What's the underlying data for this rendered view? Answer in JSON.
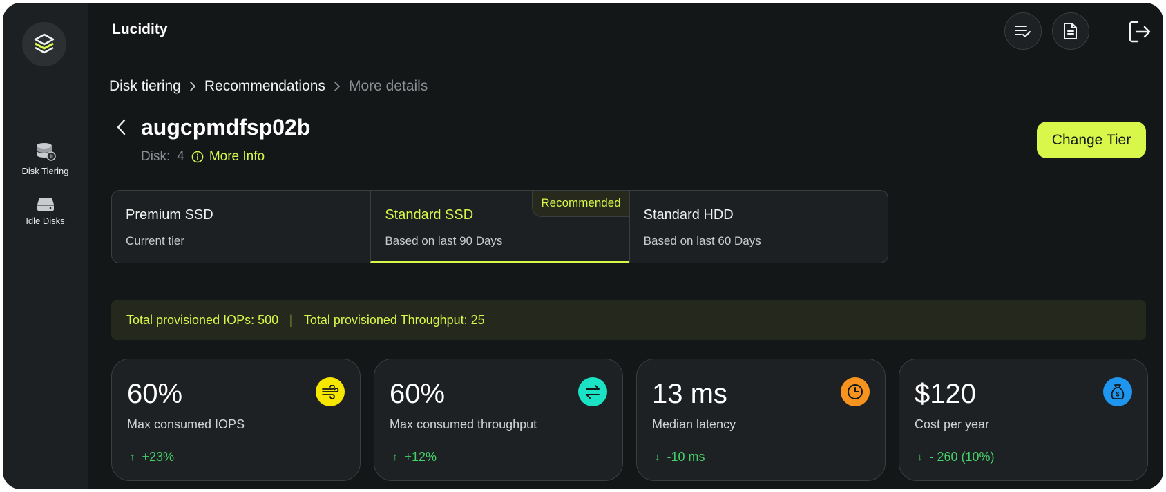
{
  "app": {
    "title": "Lucidity"
  },
  "sidebar": {
    "items": [
      {
        "label": "Disk Tiering",
        "icon": "database-icon"
      },
      {
        "label": "Idle Disks",
        "icon": "hard-drive-icon"
      }
    ]
  },
  "topbar": {
    "buttons": [
      {
        "icon": "checklist-icon"
      },
      {
        "icon": "document-icon"
      },
      {
        "icon": "logout-icon"
      }
    ]
  },
  "breadcrumb": [
    "Disk tiering",
    "Recommendations",
    "More details"
  ],
  "disk": {
    "name": "augcpmdfsp02b",
    "label": "Disk:",
    "count": "4",
    "more_info": "More Info"
  },
  "actions": {
    "change_tier": "Change Tier"
  },
  "tiers": [
    {
      "title": "Premium SSD",
      "subtitle": "Current tier"
    },
    {
      "title": "Standard SSD",
      "subtitle": "Based on last 90 Days",
      "badge": "Recommended",
      "selected": true
    },
    {
      "title": "Standard HDD",
      "subtitle": "Based on last 60 Days"
    }
  ],
  "provision": {
    "iops": "Total provisioned IOPs: 500",
    "separator": "|",
    "throughput": "Total provisioned Throughput: 25"
  },
  "metrics": [
    {
      "value": "60%",
      "label": "Max consumed IOPS",
      "delta": "+23%",
      "arrow": "↑",
      "icon": "wind-flow-icon",
      "color": "#f7e600"
    },
    {
      "value": "60%",
      "label": "Max consumed throughput",
      "delta": "+12%",
      "arrow": "↑",
      "icon": "transfer-arrows-icon",
      "color": "#19e3c4"
    },
    {
      "value": "13 ms",
      "label": "Median latency",
      "delta": "-10 ms",
      "arrow": "↓",
      "icon": "clock-icon",
      "color": "#f7931e"
    },
    {
      "value": "$120",
      "label": "Cost per year",
      "delta": "- 260 (10%)",
      "arrow": "↓",
      "icon": "money-bag-icon",
      "color": "#1e96f0"
    }
  ],
  "colors": {
    "accent": "#d8f74a",
    "positive": "#44d16a",
    "background": "#141718",
    "sidebar": "#1d2022"
  }
}
